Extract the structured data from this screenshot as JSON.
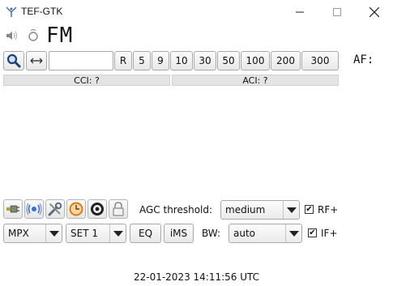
{
  "window": {
    "title": "TEF-GTK",
    "minimize_symbol": "—",
    "maximize_symbol": "☐",
    "close_symbol": "✕"
  },
  "header": {
    "mode": "FM",
    "af_label": "AF:"
  },
  "tuning": {
    "search_icon": "search-icon",
    "swap_icon": "arrows-horizontal-icon",
    "frequency_value": "",
    "step_buttons": [
      "R",
      "5",
      "9",
      "10",
      "30",
      "50",
      "100",
      "200",
      "300"
    ]
  },
  "signal_bars": {
    "cci": "CCI: ?",
    "aci": "ACI: ?"
  },
  "toolbar": {
    "icons": [
      "connect-icon",
      "antenna-icon",
      "settings-icon",
      "clock-icon",
      "rds-icon",
      "lock-icon"
    ],
    "agc_label": "AGC threshold:",
    "agc_value": "medium",
    "rf_label": "RF+",
    "rf_checked": "✔"
  },
  "controls": {
    "mpx_value": "MPX",
    "set_value": "SET 1",
    "eq_label": "EQ",
    "ims_label": "iMS",
    "bw_label": "BW:",
    "bw_value": "auto",
    "if_label": "IF+",
    "if_checked": "✔"
  },
  "status": {
    "datetime": "22-01-2023 14:11:56 UTC"
  }
}
